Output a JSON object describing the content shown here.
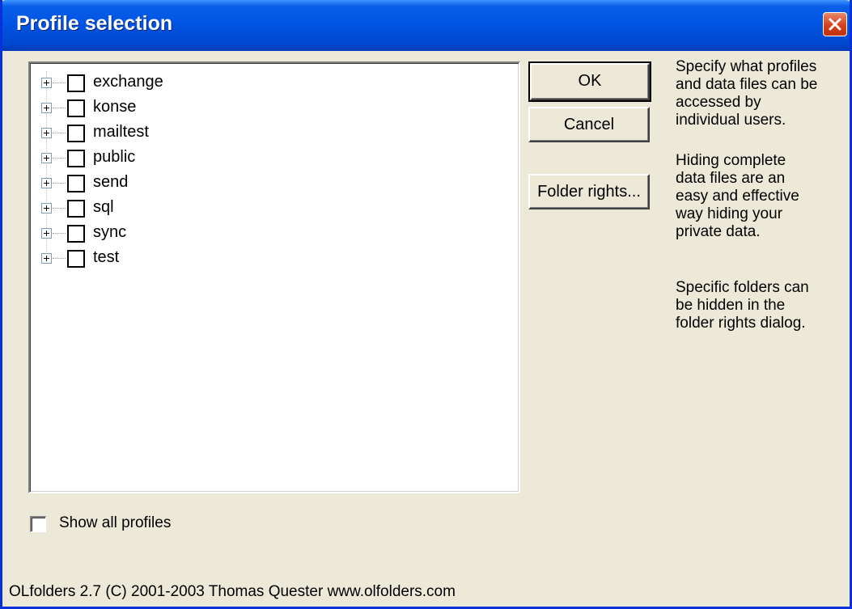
{
  "window": {
    "title": "Profile selection",
    "close_icon": "close-icon",
    "accent": "#0054e3",
    "close_color": "#d5401a"
  },
  "profiles": [
    {
      "name": "exchange",
      "checked": false
    },
    {
      "name": "konse",
      "checked": false
    },
    {
      "name": "mailtest",
      "checked": false
    },
    {
      "name": "public",
      "checked": false
    },
    {
      "name": "send",
      "checked": false
    },
    {
      "name": "sql",
      "checked": false
    },
    {
      "name": "sync",
      "checked": false
    },
    {
      "name": "test",
      "checked": false
    }
  ],
  "buttons": {
    "ok": "OK",
    "cancel": "Cancel",
    "folder_rights": "Folder rights..."
  },
  "help": {
    "p1": [
      "Specify what profiles",
      "and data files can be",
      "accessed by",
      "individual users."
    ],
    "p2": [
      "Hiding complete",
      "data files are an",
      "easy and effective",
      "way hiding your",
      "private data."
    ],
    "p3": [
      "Specific folders can",
      "be hidden in the",
      "folder rights dialog."
    ]
  },
  "show_all": {
    "label": "Show all profiles",
    "checked": false
  },
  "footer": "OLfolders 2.7 (C) 2001-2003 Thomas Quester www.olfolders.com"
}
